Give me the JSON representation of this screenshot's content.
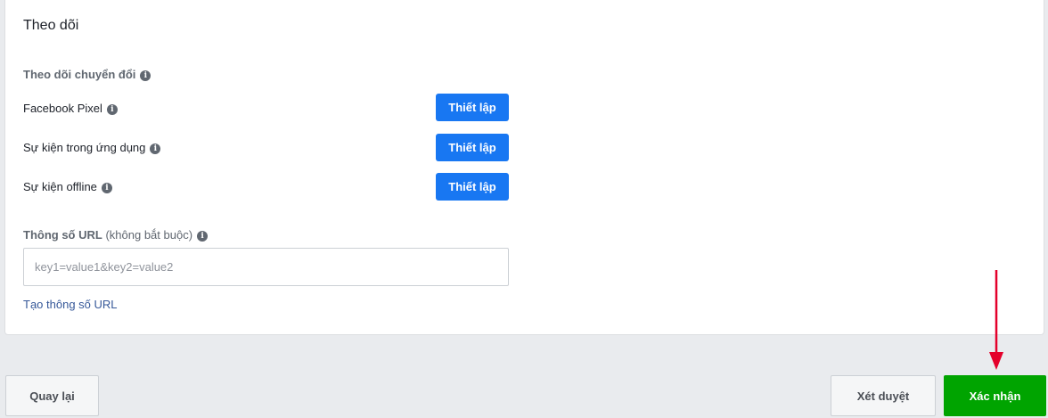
{
  "section": {
    "title": "Theo dõi",
    "conversion_label": "Theo dõi chuyển đổi",
    "rows": [
      {
        "label": "Facebook Pixel",
        "button": "Thiết lập"
      },
      {
        "label": "Sự kiện trong ứng dụng",
        "button": "Thiết lập"
      },
      {
        "label": "Sự kiện offline",
        "button": "Thiết lập"
      }
    ],
    "url_param_label": "Thông số URL",
    "url_param_optional": "(không bắt buộc)",
    "url_placeholder": "key1=value1&key2=value2",
    "url_input_value": "",
    "build_url_link": "Tạo thông số URL"
  },
  "footer": {
    "back_label": "Quay lại",
    "review_label": "Xét duyệt",
    "confirm_label": "Xác nhận"
  },
  "colors": {
    "primary_blue": "#1877f2",
    "confirm_green": "#00a400",
    "annotation_arrow": "#e4002b",
    "link": "#365899"
  },
  "icons": {
    "info": "info-icon",
    "annotation": "down-arrow-annotation"
  }
}
